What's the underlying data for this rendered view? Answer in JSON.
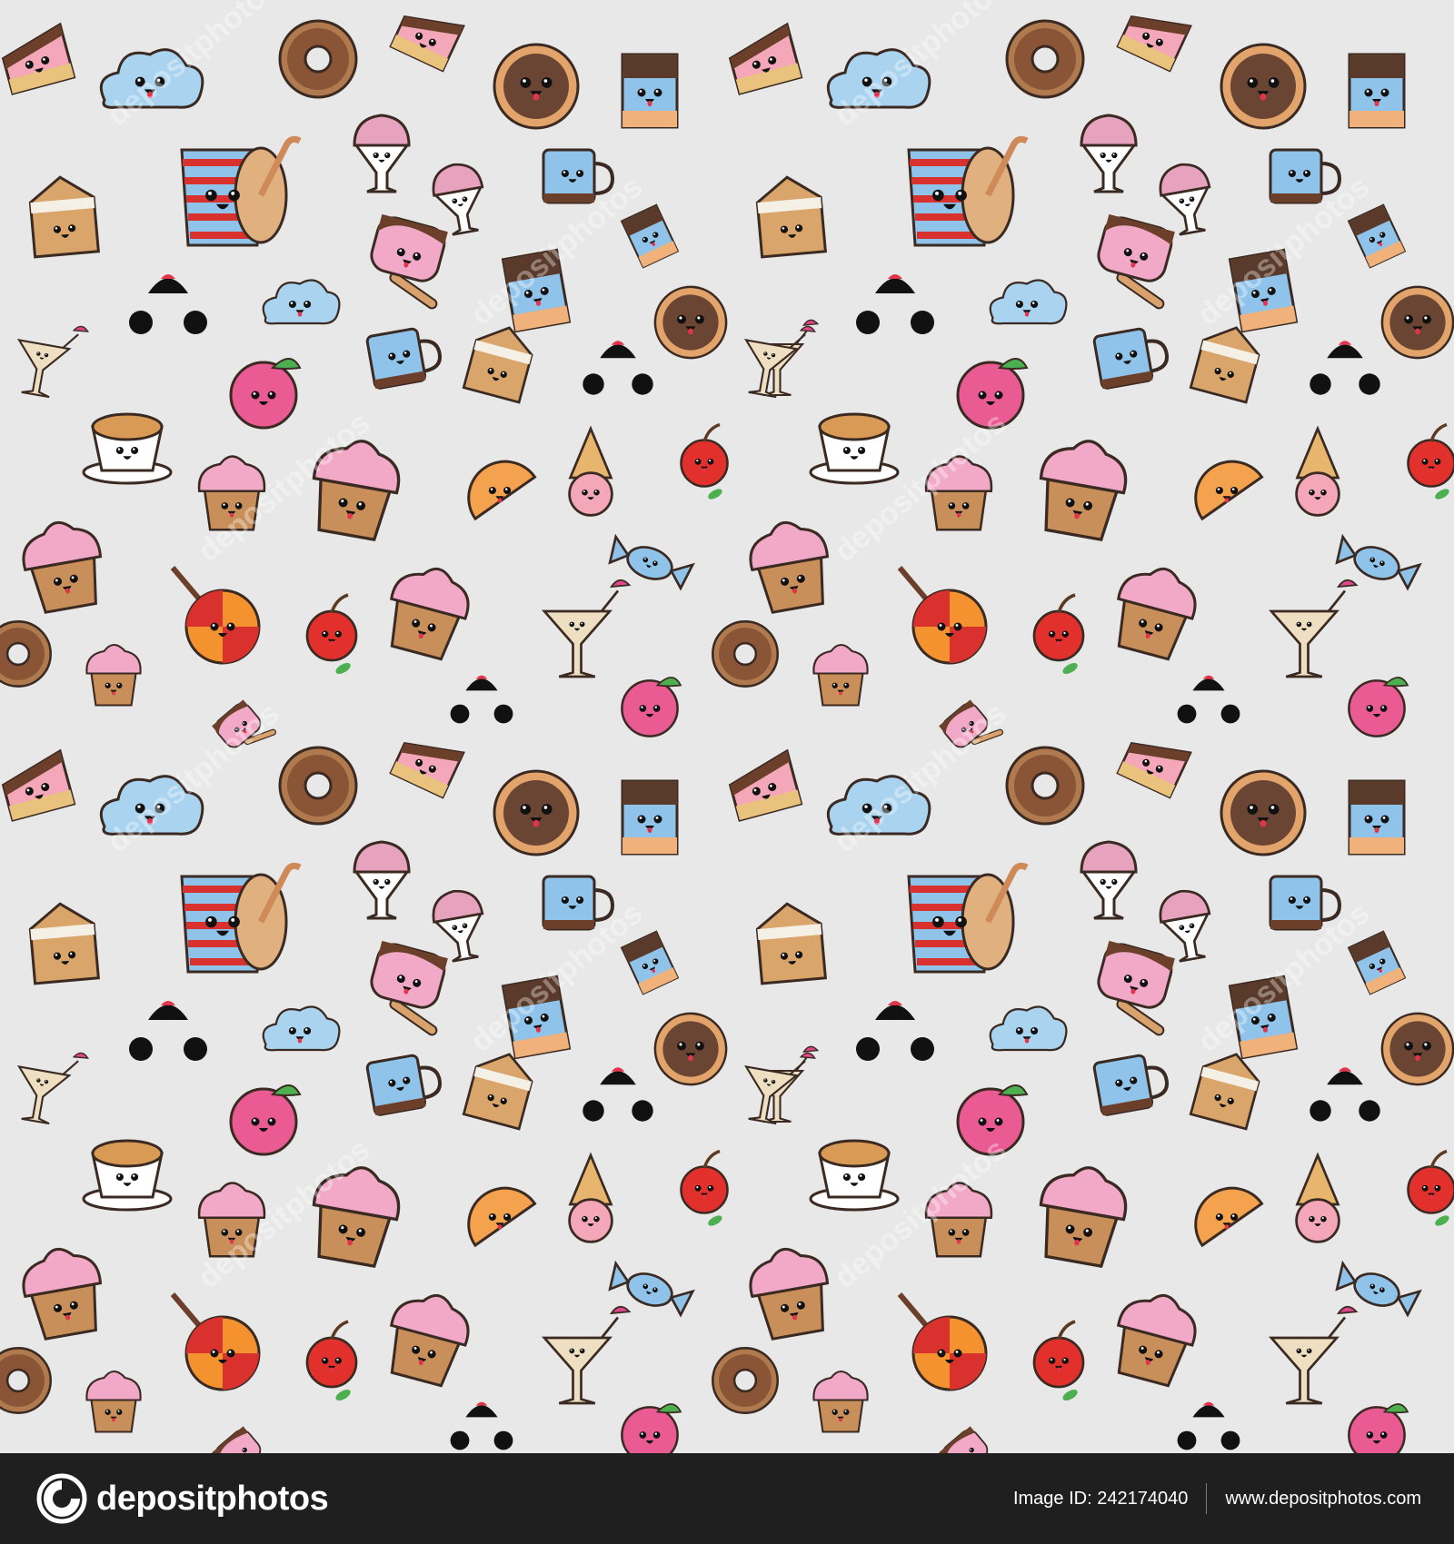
{
  "image": {
    "background_color": "#e8e8e8",
    "subject": "seamless pattern of cute kawaii food characters",
    "item_types": [
      "cake-slice",
      "cloud",
      "donut",
      "pie",
      "chocolate-bar",
      "cupcake",
      "soda-cup",
      "ice-cream-sundae",
      "mug",
      "popsicle",
      "lollipop",
      "cherry",
      "ice-cream-cone",
      "orange-slice",
      "cocktail-glass",
      "candy",
      "coffee-cup",
      "peach",
      "milk-carton",
      "face-parts"
    ],
    "watermark_text": "depositphotos"
  },
  "footer": {
    "brand_name": "depositphotos",
    "image_id": "Image ID: 242174040",
    "website": "www.depositphotos.com",
    "background_color": "#1f1f1f",
    "text_color": "#ffffff"
  }
}
